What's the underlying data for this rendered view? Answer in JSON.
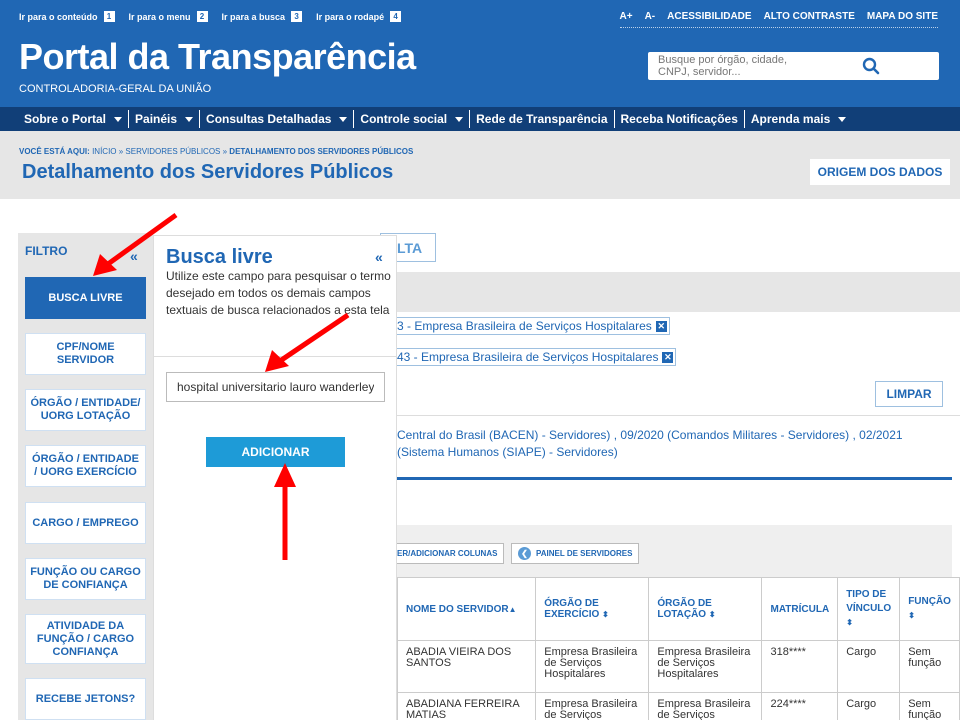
{
  "skip_links": [
    {
      "label": "Ir para o conteúdo",
      "key": "1"
    },
    {
      "label": "Ir para o menu",
      "key": "2"
    },
    {
      "label": "Ir para a busca",
      "key": "3"
    },
    {
      "label": "Ir para o rodapé",
      "key": "4"
    }
  ],
  "accessibility": [
    "A+",
    "A-",
    "ACESSIBILIDADE",
    "ALTO CONTRASTE",
    "MAPA DO SITE"
  ],
  "site": {
    "title": "Portal da Transparência",
    "subtitle": "CONTROLADORIA-GERAL DA UNIÃO"
  },
  "search": {
    "placeholder": "Busque por órgão, cidade, CNPJ, servidor..."
  },
  "nav": [
    "Sobre o Portal",
    "Painéis",
    "Consultas Detalhadas",
    "Controle social",
    "Rede de Transparência",
    "Receba Notificações",
    "Aprenda mais"
  ],
  "breadcrumb": {
    "prefix": "VOCÊ ESTÁ AQUI:",
    "path": "INÍCIO » SERVIDORES PÚBLICOS » ",
    "current": "DETALHAMENTO DOS SERVIDORES PÚBLICOS"
  },
  "page": {
    "title": "Detalhamento dos Servidores Públicos",
    "origem": "ORIGEM DOS DADOS"
  },
  "main": {
    "consulta_tab": "LTA",
    "chips": [
      "3 - Empresa Brasileira de Serviços Hospitalares",
      "43 - Empresa Brasileira de Serviços Hospitalares"
    ],
    "limpar": "LIMPAR",
    "bases_text": "Central do Brasil (BACEN) - Servidores) , 09/2020 (Comandos Militares - Servidores) , 02/2021 (Sistema Humanos (SIAPE) - Servidores)",
    "btn_columns": "ER/ADICIONAR COLUNAS",
    "btn_painel": "PAINEL DE SERVIDORES"
  },
  "table": {
    "headers": [
      "NOME DO SERVIDOR",
      "ÓRGÃO DE EXERCÍCIO",
      "ÓRGÃO DE LOTAÇÃO",
      "MATRÍCULA",
      "TIPO DE VÍNCULO",
      "FUNÇÃO"
    ],
    "rows": [
      [
        "ABADIA VIEIRA DOS SANTOS",
        "Empresa Brasileira de Serviços Hospitalares",
        "Empresa Brasileira de Serviços Hospitalares",
        "318****",
        "Cargo",
        "Sem função"
      ],
      [
        "ABADIANA FERREIRA MATIAS",
        "Empresa Brasileira de Serviços Hospitalares",
        "Empresa Brasileira de Serviços Hospitalares",
        "224****",
        "Cargo",
        "Sem função"
      ]
    ]
  },
  "filter": {
    "title": "FILTRO",
    "items": [
      "BUSCA LIVRE",
      "CPF/NOME SERVIDOR",
      "ÓRGÃO / ENTIDADE/ UORG LOTAÇÃO",
      "ÓRGÃO / ENTIDADE / UORG EXERCÍCIO",
      "CARGO / EMPREGO",
      "FUNÇÃO OU CARGO DE CONFIANÇA",
      "ATIVIDADE DA FUNÇÃO / CARGO CONFIANÇA",
      "RECEBE JETONS?"
    ]
  },
  "busca": {
    "title": "Busca livre",
    "description": "Utilize este campo para pesquisar o termo desejado em todos os demais campos textuais de busca relacionados a esta tela",
    "value": "hospital universitario lauro wanderley",
    "add_label": "ADICIONAR"
  },
  "colors": {
    "primary": "#2067b4",
    "nav": "#113f78",
    "add_button": "#1e9bd7",
    "arrow": "#ff0000"
  },
  "icons": {
    "search": "search-icon",
    "collapse": "double-chevron-left-icon",
    "remove": "close-icon",
    "painel": "chevron-left-circle-icon"
  }
}
